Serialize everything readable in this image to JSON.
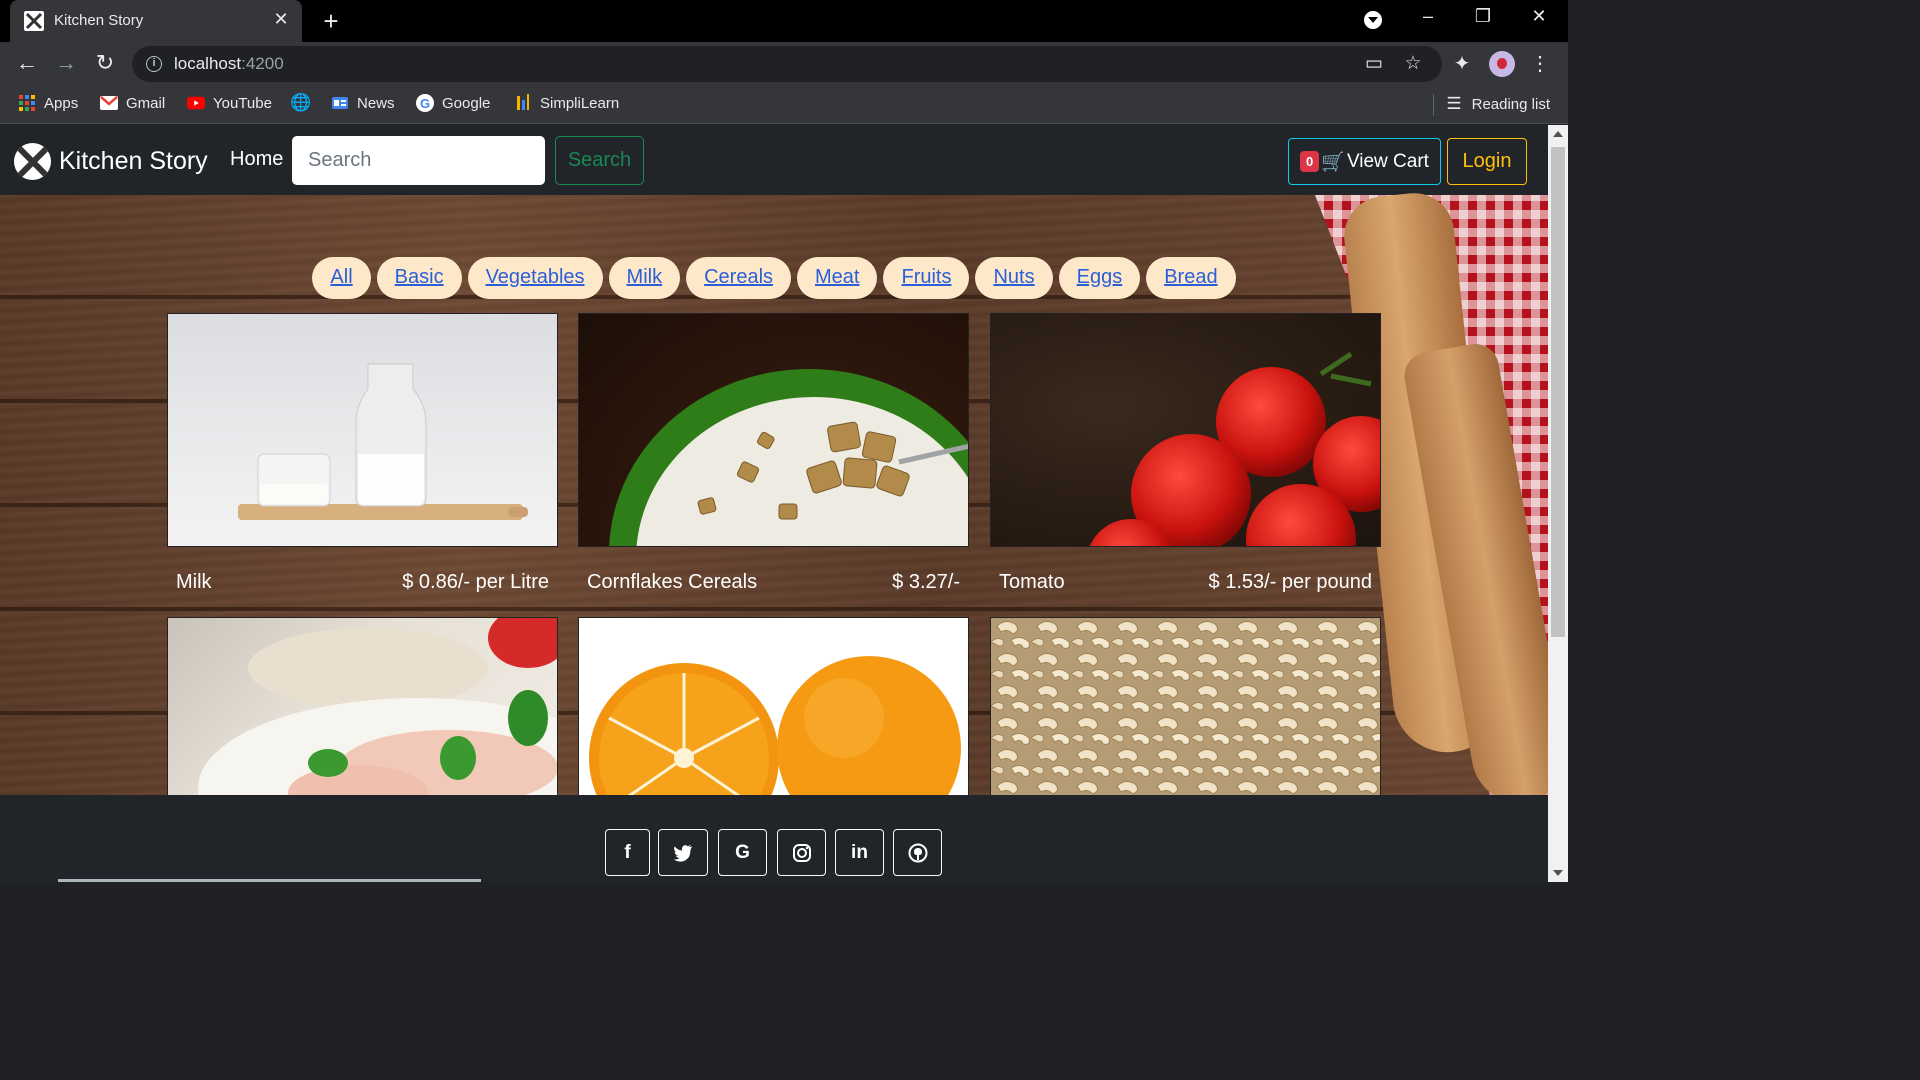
{
  "browser": {
    "tab_title": "Kitchen Story",
    "url_host": "localhost",
    "url_port": ":4200",
    "bookmarks": [
      "Apps",
      "Gmail",
      "YouTube",
      "News",
      "Google",
      "SimpliLearn"
    ],
    "reading_list": "Reading list"
  },
  "navbar": {
    "brand": "Kitchen Story",
    "home": "Home",
    "search_placeholder": "Search",
    "search_button": "Search",
    "cart_count": "0",
    "cart_label": "View Cart",
    "login": "Login"
  },
  "categories": [
    "All",
    "Basic",
    "Vegetables",
    "Milk",
    "Cereals",
    "Meat",
    "Fruits",
    "Nuts",
    "Eggs",
    "Bread"
  ],
  "products": [
    {
      "name": "Milk",
      "price": "$ 0.86/- per Litre"
    },
    {
      "name": "Cornflakes Cereals",
      "price": "$ 3.27/-"
    },
    {
      "name": "Tomato",
      "price": "$ 1.53/- per pound"
    }
  ],
  "footer": {
    "social_icons": [
      "facebook-icon",
      "twitter-icon",
      "google-icon",
      "instagram-icon",
      "linkedin-icon",
      "github-icon"
    ],
    "social_glyphs": [
      "f",
      "🐦",
      "G",
      "◎",
      "in",
      "⊙"
    ]
  },
  "colors": {
    "navbar_bg": "#212529",
    "search_btn": "#198754",
    "cart_btn_border": "#0dcaf0",
    "cart_badge": "#dc3545",
    "login": "#ffc107",
    "category_pill": "#fde9c9",
    "category_link": "#2b5fd9"
  }
}
